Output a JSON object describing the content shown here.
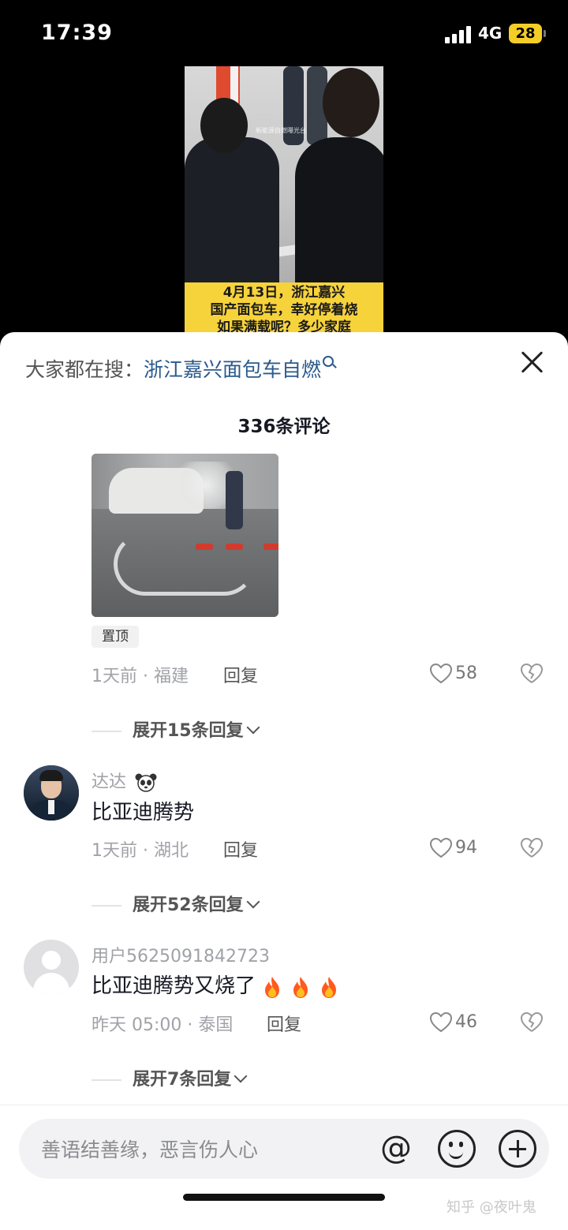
{
  "status_bar": {
    "time": "17:39",
    "network": "4G",
    "battery": "28"
  },
  "video": {
    "watermark": "新能源自燃曝光台",
    "caption_lines": [
      "4月13日，浙江嘉兴",
      "国产面包车，幸好停着烧",
      "如果满载呢？多少家庭"
    ]
  },
  "search_bar": {
    "prefix": "大家都在搜：",
    "term": "浙江嘉兴面包车自燃"
  },
  "comment_count": "336条评论",
  "comments": [
    {
      "pin_label": "置顶",
      "time": "1天前 · 福建",
      "reply_label": "回复",
      "likes": "58",
      "expand_label": "展开15条回复"
    },
    {
      "username": "达达",
      "text": "比亚迪腾势",
      "time": "1天前 · 湖北",
      "reply_label": "回复",
      "likes": "94",
      "expand_label": "展开52条回复"
    },
    {
      "username": "用户5625091842723",
      "text": "比亚迪腾势又烧了",
      "time": "昨天 05:00 · 泰国",
      "reply_label": "回复",
      "likes": "46",
      "expand_label": "展开7条回复"
    }
  ],
  "input": {
    "placeholder": "善语结善缘，恶言伤人心"
  },
  "watermark": "知乎 @夜叶鬼",
  "colors": {
    "link_blue": "#2b5a8c",
    "caption_yellow": "#f7d33b",
    "text_dark": "#161823",
    "meta_gray": "#a0a2a7"
  },
  "icons": [
    "search-icon",
    "close-icon",
    "heart-icon",
    "dislike-icon",
    "chevron-down-icon",
    "panda-icon",
    "fire-icon",
    "at-icon",
    "emoji-icon",
    "plus-icon"
  ]
}
